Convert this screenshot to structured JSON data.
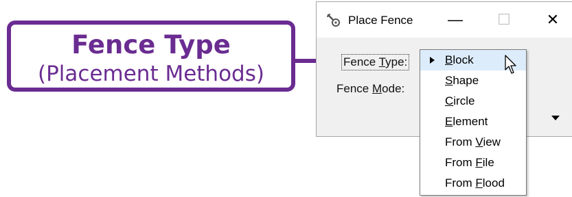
{
  "callout": {
    "title": "Fence Type",
    "subtitle": "(Placement Methods)",
    "color": "#6a2c91"
  },
  "window": {
    "title": "Place Fence",
    "app_icon": "wrench-gear-icon",
    "minimize_label": "—",
    "maximize_label": "☐",
    "close_label": "✕"
  },
  "form": {
    "fence_type": {
      "pre": "Fence ",
      "accel": "T",
      "post": "ype:"
    },
    "fence_mode": {
      "pre": "Fence ",
      "accel": "M",
      "post": "ode:"
    }
  },
  "dropdown": {
    "selected_index": 0,
    "items": [
      {
        "pre": "",
        "accel": "B",
        "post": "lock"
      },
      {
        "pre": "",
        "accel": "S",
        "post": "hape"
      },
      {
        "pre": "",
        "accel": "C",
        "post": "ircle"
      },
      {
        "pre": "",
        "accel": "E",
        "post": "lement"
      },
      {
        "pre": "From ",
        "accel": "V",
        "post": "iew"
      },
      {
        "pre": "From ",
        "accel": "F",
        "post": "ile"
      },
      {
        "pre": "From ",
        "accel": "F",
        "post": "lood"
      }
    ]
  }
}
